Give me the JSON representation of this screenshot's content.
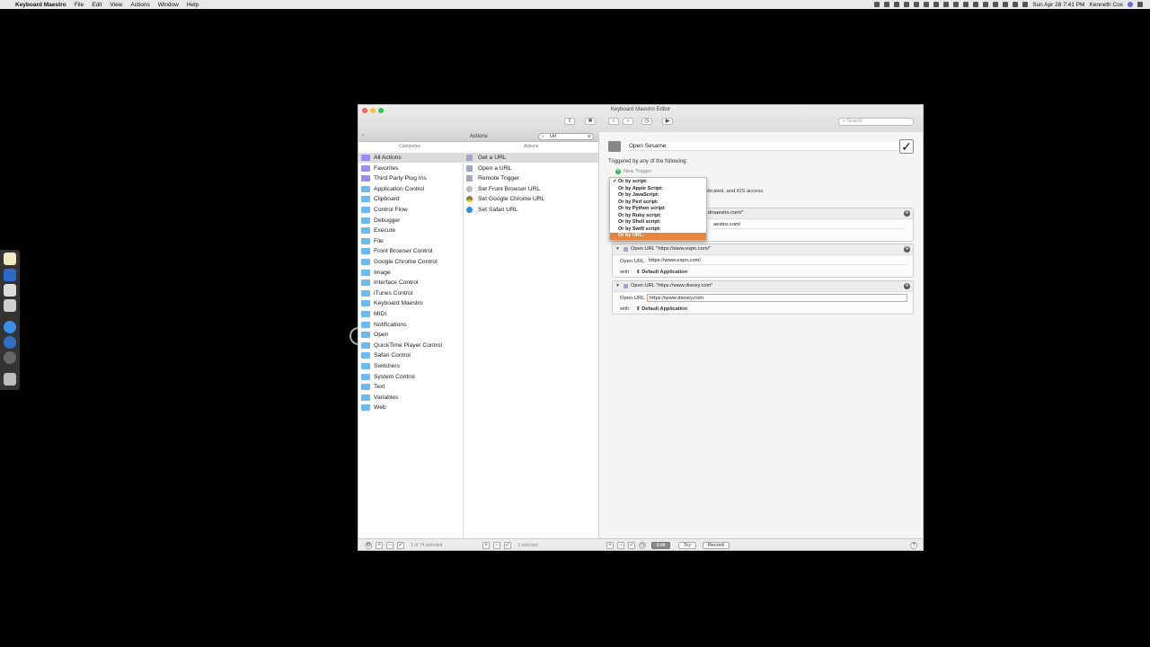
{
  "menubar": {
    "app": "Keyboard Maestro",
    "items": [
      "File",
      "Edit",
      "View",
      "Actions",
      "Window",
      "Help"
    ],
    "clock": "Sun Apr 28  7:41 PM",
    "user": "Kenneth Cox"
  },
  "window": {
    "title": "Keyboard Maestro Editor",
    "search_placeholder": "Search"
  },
  "left": {
    "header_title": "Actions",
    "filter_value": "Url",
    "categories_header": "Categories",
    "actions_header": "Actions",
    "categories": [
      "All Actions",
      "Favorites",
      "Third Party Plug Ins",
      "Application Control",
      "Clipboard",
      "Control Flow",
      "Debugger",
      "Execute",
      "File",
      "Front Browser Control",
      "Google Chrome Control",
      "Image",
      "Interface Control",
      "iTunes Control",
      "Keyboard Maestro",
      "MIDI",
      "Notifications",
      "Open",
      "QuickTime Player Control",
      "Safari Control",
      "Switchers",
      "System Control",
      "Text",
      "Variables",
      "Web"
    ],
    "actions": [
      "Get a URL",
      "Open a URL",
      "Remote Trigger",
      "Set Front Browser URL",
      "Set Google Chrome URL",
      "Set Safari URL"
    ],
    "footer_left": "1 of 74 selected",
    "footer_right": "1 selected"
  },
  "macro": {
    "name": "Open Sesame",
    "triggered_label": "Triggered by any of the following:",
    "new_trigger": "New Trigger",
    "obscured_text_1": "nticated, and iOS access.",
    "actions": [
      {
        "title": "",
        "field_label": "",
        "url": "",
        "app": "",
        "head_tail": "dmaestro.com/\"",
        "field_tail": "aestro.com/"
      },
      {
        "title": "Open URL \"https://www.espn.com/\"",
        "field_label": "Open URL",
        "url": "https://www.espn.com/",
        "with_label": "with",
        "app": "Default Application"
      },
      {
        "title": "Open URL \"https://www.disney.com\"",
        "field_label": "Open URL",
        "url": "https://www.disney.com",
        "with_label": "with",
        "app": "Default Application"
      }
    ]
  },
  "right_footer": {
    "edit": "Edit",
    "try": "Try",
    "record": "Record",
    "help": "?"
  },
  "dropdown": {
    "items": [
      "Or by script:",
      "Or by Apple Script:",
      "Or by JavaScript:",
      "Or by Perl script:",
      "Or by Python script:",
      "Or by Ruby script:",
      "Or by Shell script:",
      "Or by Swift script:",
      "Or by URL:"
    ],
    "checked_index": 0,
    "highlighted_index": 8
  },
  "colors": {
    "highlight": "#e8853a",
    "folder": "#6bbbf0",
    "purple_folder": "#9a8cf0",
    "focus_ring": "#e8a06a"
  }
}
